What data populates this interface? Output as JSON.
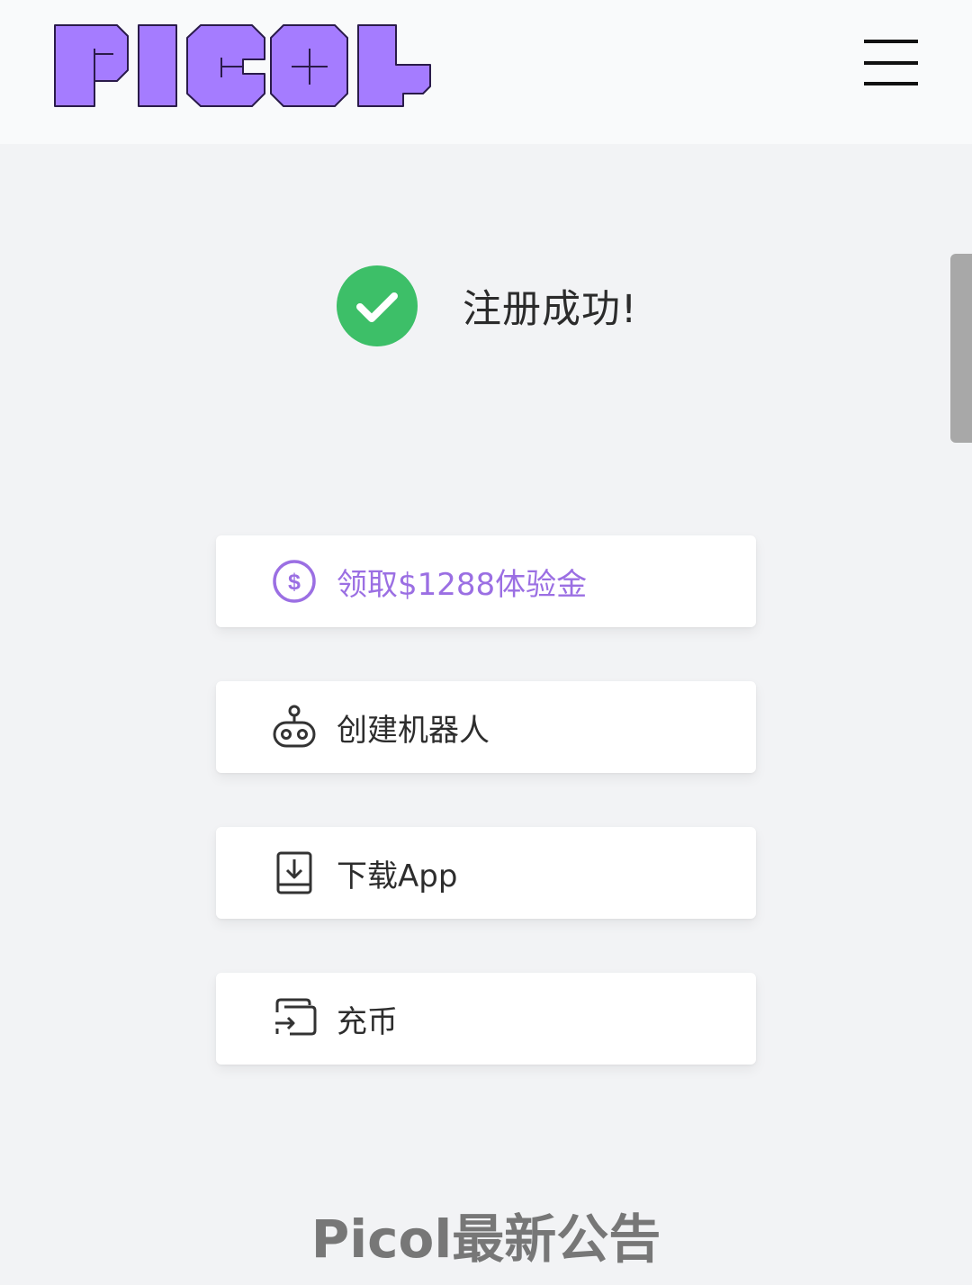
{
  "header": {
    "logo_text": "PICOL",
    "menu_icon": "hamburger-menu-icon"
  },
  "status": {
    "message": "注册成功!",
    "icon": "check-circle-icon",
    "color": "#3dbf68"
  },
  "actions": [
    {
      "label": "领取$1288体验金",
      "icon": "dollar-circle-icon",
      "color": "#9b6fe3"
    },
    {
      "label": "创建机器人",
      "icon": "robot-icon"
    },
    {
      "label": "下载App",
      "icon": "download-icon"
    },
    {
      "label": "充币",
      "icon": "deposit-icon"
    }
  ],
  "news": {
    "title": "Picol最新公告"
  },
  "colors": {
    "brand": "#a57cff",
    "background": "#f2f3f5",
    "header_bg": "#f9fafb"
  }
}
